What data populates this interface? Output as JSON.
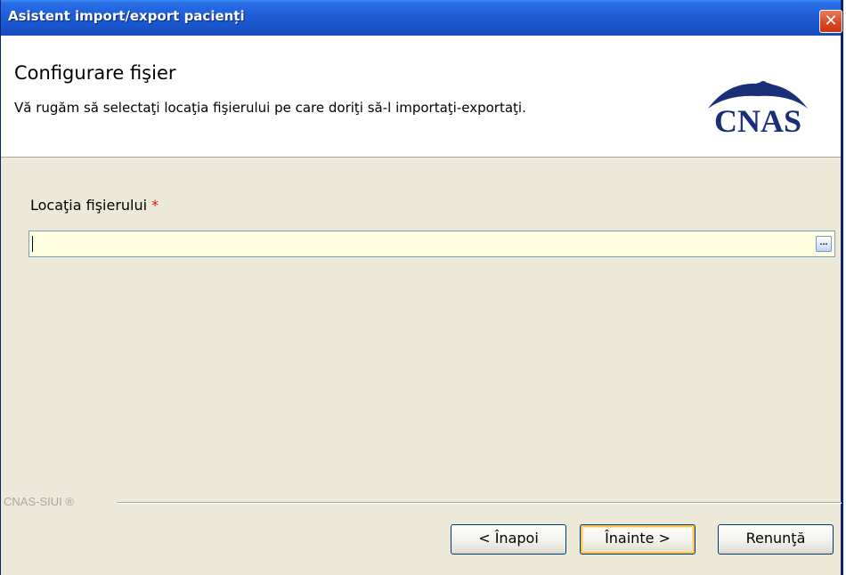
{
  "window": {
    "title": "Asistent import/export pacienți",
    "close_glyph": "✕"
  },
  "header": {
    "title": "Configurare fişier",
    "subtitle": "Vă rugăm să selectaţi locaţia fişierului pe care doriţi să-l importaţi-exportaţi.",
    "logo_text": "CNAS",
    "logo_icon": "cnas-bird-logo"
  },
  "form": {
    "location_label": "Locaţia fişierului",
    "required_marker": "*",
    "location_value": "",
    "browse_label": "..."
  },
  "footer": {
    "brand": "CNAS-SIUI ®"
  },
  "buttons": {
    "back": "< Înapoi",
    "next": "Înainte >",
    "cancel": "Renunţă"
  },
  "colors": {
    "titlebar": "#1e5fd8",
    "dialog_bg": "#ece9d8",
    "input_bg": "#ffffe1",
    "required": "#e01010",
    "logo_blue": "#1a2f7a"
  }
}
